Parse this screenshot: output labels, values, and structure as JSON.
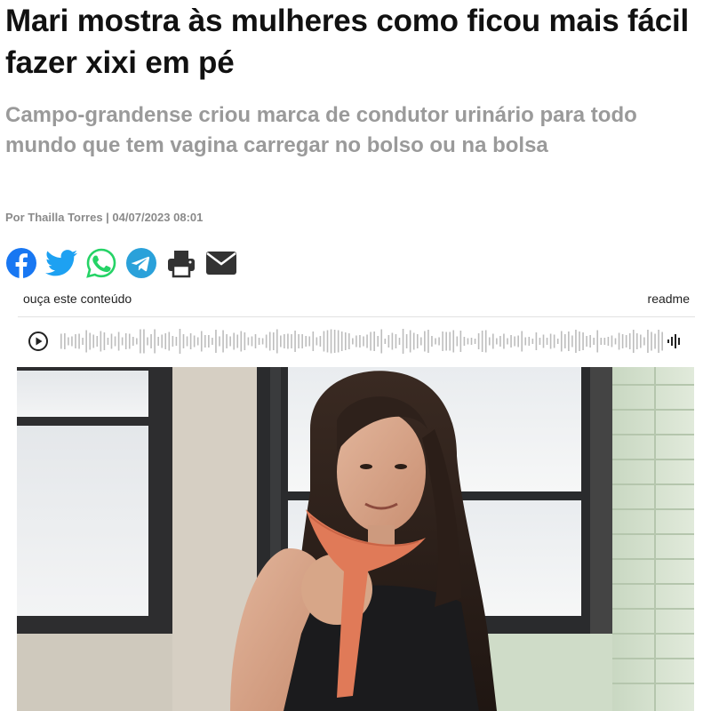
{
  "article": {
    "headline": "Mari mostra às mulheres como ficou mais fácil fazer xixi em pé",
    "subtitle": "Campo-grandense criou marca de condutor urinário para todo mundo que tem vagina carregar no bolso ou na bolsa",
    "byline": "Por Thailla Torres | 04/07/2023 08:01"
  },
  "share": {
    "icons": [
      "facebook-icon",
      "twitter-icon",
      "whatsapp-icon",
      "telegram-icon",
      "print-icon",
      "email-icon"
    ],
    "colors": {
      "facebook": "#1877f2",
      "twitter": "#1da1f2",
      "whatsapp": "#25d366",
      "telegram": "#2aa1da",
      "neutral": "#333333"
    }
  },
  "audio": {
    "label": "ouça este conteúdo",
    "brand": "readme"
  },
  "photo": {
    "description_icon": "photo-woman-holding-urinary-funnel"
  }
}
